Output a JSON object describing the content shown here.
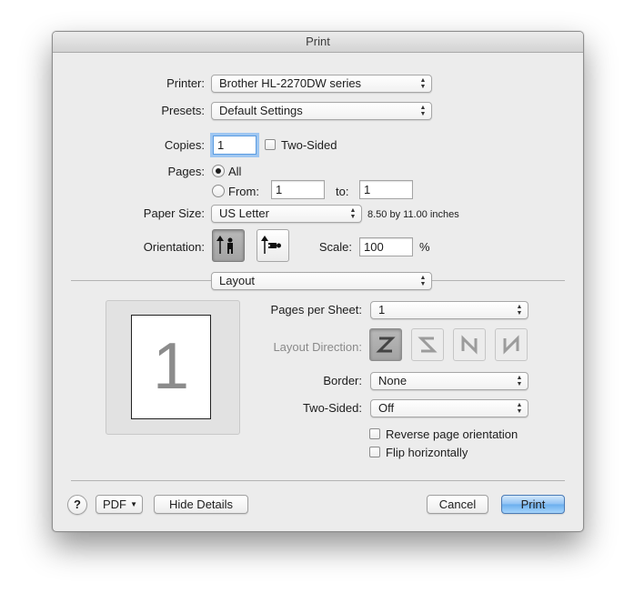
{
  "window": {
    "title": "Print"
  },
  "printer": {
    "label": "Printer:",
    "value": "Brother HL-2270DW series"
  },
  "presets": {
    "label": "Presets:",
    "value": "Default Settings"
  },
  "copies": {
    "label": "Copies:",
    "value": "1",
    "two_sided_label": "Two-Sided",
    "two_sided_checked": false
  },
  "pages": {
    "label": "Pages:",
    "all_label": "All",
    "from_label": "From:",
    "from_value": "1",
    "to_label": "to:",
    "to_value": "1",
    "selected": "All"
  },
  "paper_size": {
    "label": "Paper Size:",
    "value": "US Letter",
    "dimensions": "8.50 by 11.00 inches"
  },
  "orientation": {
    "label": "Orientation:",
    "selected": "portrait"
  },
  "scale": {
    "label": "Scale:",
    "value": "100",
    "unit": "%"
  },
  "section": {
    "value": "Layout"
  },
  "preview": {
    "page_number": "1"
  },
  "layout": {
    "pages_per_sheet": {
      "label": "Pages per Sheet:",
      "value": "1"
    },
    "layout_direction": {
      "label": "Layout Direction:"
    },
    "border": {
      "label": "Border:",
      "value": "None"
    },
    "two_sided": {
      "label": "Two-Sided:",
      "value": "Off"
    },
    "reverse_orientation": {
      "label": "Reverse page orientation",
      "checked": false
    },
    "flip_horizontally": {
      "label": "Flip horizontally",
      "checked": false
    }
  },
  "footer": {
    "help": "?",
    "pdf_label": "PDF",
    "hide_details": "Hide Details",
    "cancel": "Cancel",
    "print": "Print"
  }
}
